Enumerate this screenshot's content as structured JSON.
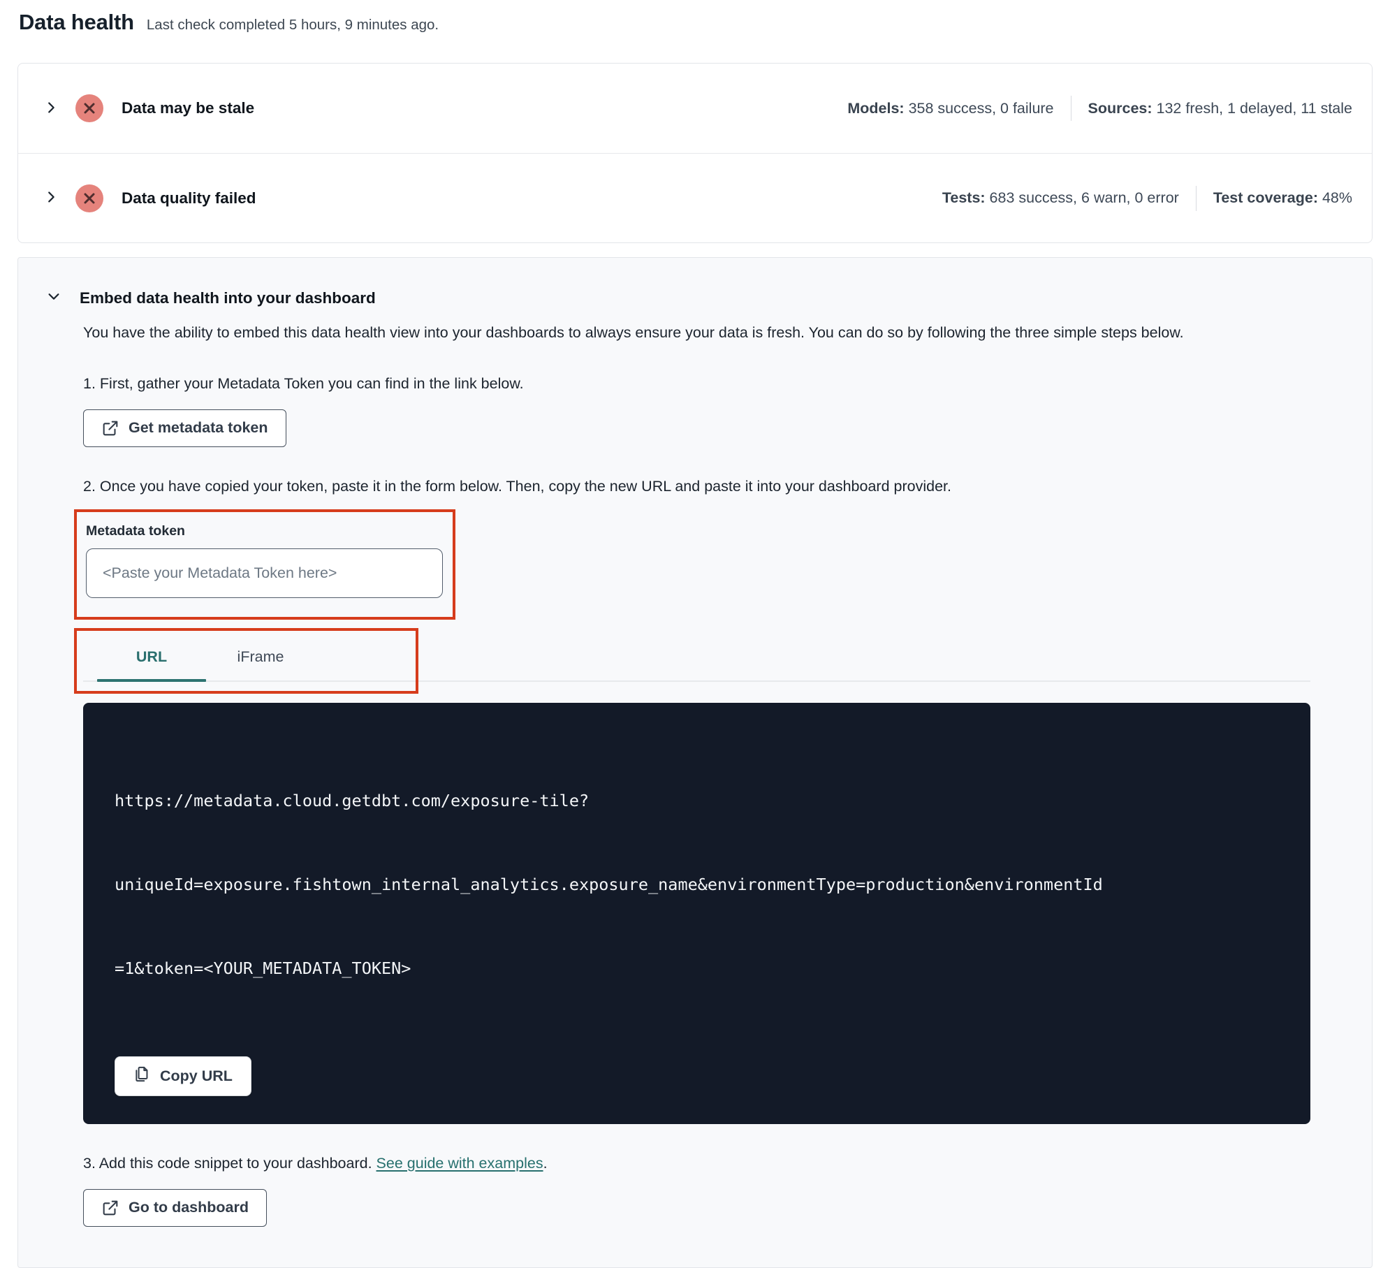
{
  "page": {
    "title": "Data health",
    "subtitle": "Last check completed 5 hours, 9 minutes ago."
  },
  "status_rows": [
    {
      "title": "Data may be stale",
      "stats": [
        {
          "label": "Models:",
          "value": " 358 success, 0 failure"
        },
        {
          "label": "Sources:",
          "value": " 132 fresh, 1 delayed, 11 stale"
        }
      ]
    },
    {
      "title": "Data quality failed",
      "stats": [
        {
          "label": "Tests:",
          "value": " 683 success, 6 warn, 0 error"
        },
        {
          "label": "Test coverage:",
          "value": " 48%"
        }
      ]
    }
  ],
  "embed": {
    "title": "Embed data health into your dashboard",
    "description": "You have the ability to embed this data health view into your dashboards to always ensure your data is fresh. You can do so by following the three simple steps below.",
    "step1": "1. First, gather your Metadata Token you can find in the link below.",
    "get_token_button": "Get metadata token",
    "step2": "2. Once you have copied your token, paste it in the form below. Then, copy the new URL and paste it into your dashboard provider.",
    "token_label": "Metadata token",
    "token_placeholder": "<Paste your Metadata Token here>",
    "tabs": [
      {
        "label": "URL"
      },
      {
        "label": "iFrame"
      }
    ],
    "code_lines": {
      "line1": "https://metadata.cloud.getdbt.com/exposure-tile?",
      "line2": "uniqueId=exposure.fishtown_internal_analytics.exposure_name&environmentType=production&environmentId",
      "line3": "=1&token=<YOUR_METADATA_TOKEN>"
    },
    "copy_button": "Copy URL",
    "step3_prefix": "3. Add this code snippet to your dashboard. ",
    "step3_link": "See guide with examples",
    "step3_suffix": ".",
    "dashboard_button": "Go to dashboard"
  },
  "colors": {
    "error_badge_bg": "#e5837c",
    "error_badge_x": "#4f2d2e",
    "highlight_red": "#d63c1c",
    "accent_teal": "#2a6f6e",
    "code_bg": "#131a28"
  }
}
